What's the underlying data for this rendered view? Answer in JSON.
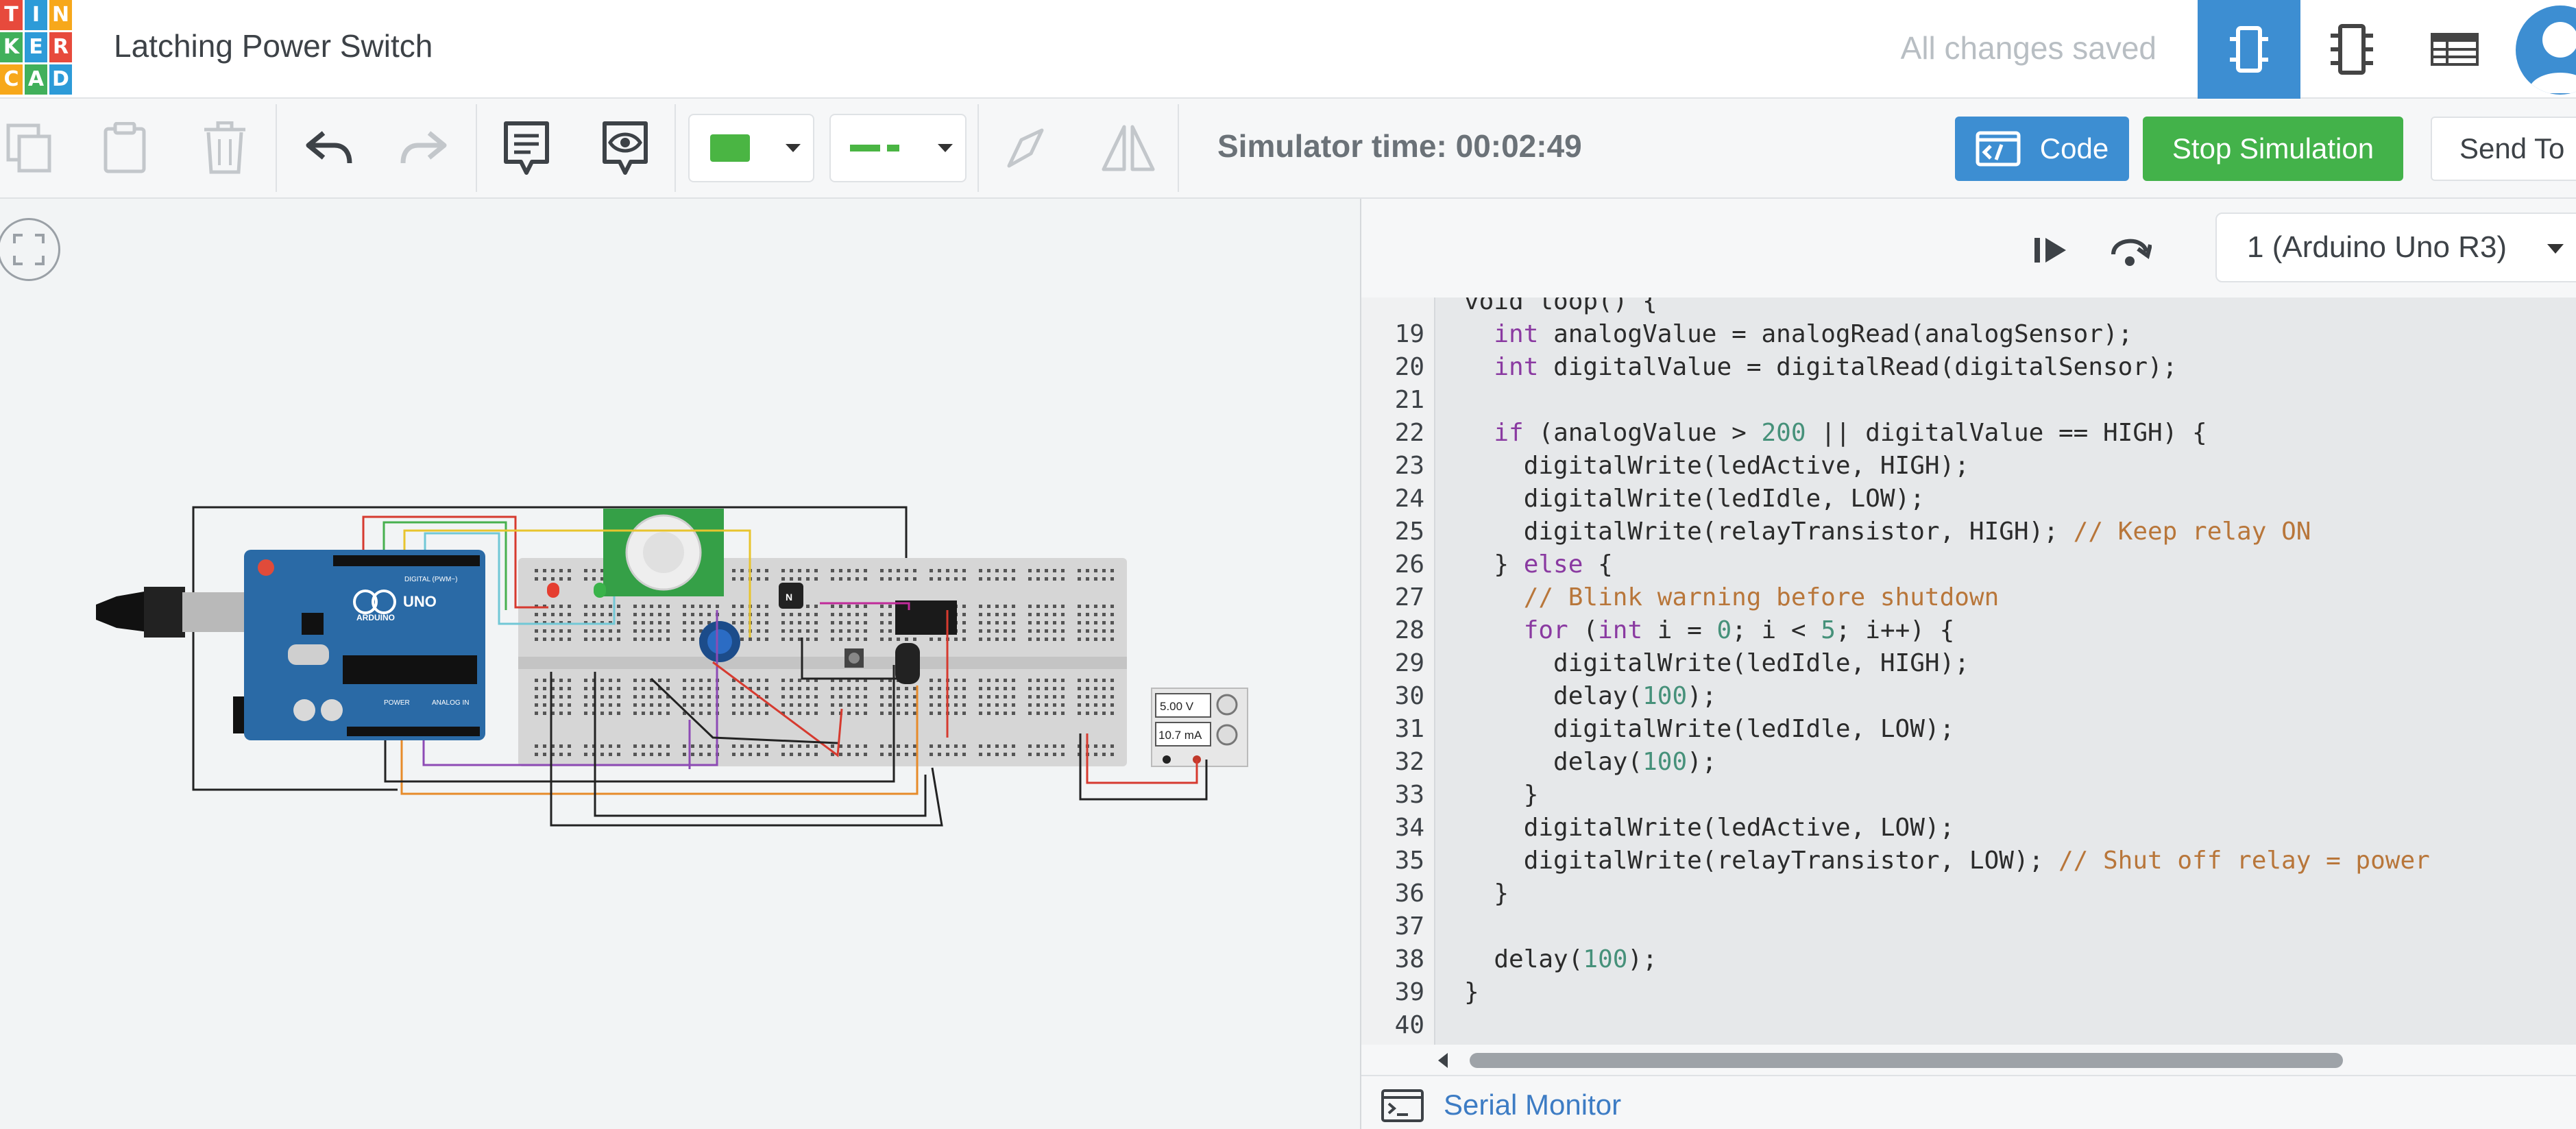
{
  "header": {
    "project_title": "Latching Power Switch",
    "save_status": "All changes saved",
    "logo_letters": [
      "T",
      "I",
      "N",
      "K",
      "E",
      "R",
      "C",
      "A",
      "D"
    ],
    "logo_colors": [
      "#e74a3c",
      "#2d9bd8",
      "#f7a81b",
      "#41b05b",
      "#2d9bd8",
      "#e74a3c",
      "#f7a81b",
      "#41b05b",
      "#2d9bd8"
    ],
    "views": [
      "circuit-view",
      "schematic-view",
      "component-list-view"
    ]
  },
  "toolbar": {
    "sim_time_label": "Simulator time:",
    "sim_time_value": "00:02:49",
    "code_label": "Code",
    "stop_label": "Stop Simulation",
    "send_label": "Send To",
    "color_swatch": "#4ab543"
  },
  "code_panel": {
    "board": "1 (Arduino Uno R3)",
    "serial_monitor": "Serial Monitor",
    "top_fragment": "void loop() {",
    "lines": [
      {
        "n": "19",
        "tokens": [
          [
            "",
            "  "
          ],
          [
            "kw",
            "int"
          ],
          [
            "",
            " analogValue = analogRead(analogSensor);"
          ]
        ]
      },
      {
        "n": "20",
        "tokens": [
          [
            "",
            "  "
          ],
          [
            "kw",
            "int"
          ],
          [
            "",
            " digitalValue = digitalRead(digitalSensor);"
          ]
        ]
      },
      {
        "n": "21",
        "tokens": []
      },
      {
        "n": "22",
        "tokens": [
          [
            "",
            "  "
          ],
          [
            "kw",
            "if"
          ],
          [
            "",
            " (analogValue > "
          ],
          [
            "num",
            "200"
          ],
          [
            "",
            " || digitalValue == HIGH) {"
          ]
        ]
      },
      {
        "n": "23",
        "tokens": [
          [
            "",
            "    digitalWrite(ledActive, HIGH);"
          ]
        ]
      },
      {
        "n": "24",
        "tokens": [
          [
            "",
            "    digitalWrite(ledIdle, LOW);"
          ]
        ]
      },
      {
        "n": "25",
        "tokens": [
          [
            "",
            "    digitalWrite(relayTransistor, HIGH); "
          ],
          [
            "cm",
            "// Keep relay ON"
          ]
        ]
      },
      {
        "n": "26",
        "tokens": [
          [
            "",
            "  } "
          ],
          [
            "kw",
            "else"
          ],
          [
            "",
            " {"
          ]
        ]
      },
      {
        "n": "27",
        "tokens": [
          [
            "",
            "    "
          ],
          [
            "cm",
            "// Blink warning before shutdown"
          ]
        ]
      },
      {
        "n": "28",
        "tokens": [
          [
            "",
            "    "
          ],
          [
            "kw",
            "for"
          ],
          [
            "",
            " ("
          ],
          [
            "kw",
            "int"
          ],
          [
            "",
            " i = "
          ],
          [
            "num",
            "0"
          ],
          [
            "",
            "; i < "
          ],
          [
            "num",
            "5"
          ],
          [
            "",
            "; i++) {"
          ]
        ]
      },
      {
        "n": "29",
        "tokens": [
          [
            "",
            "      digitalWrite(ledIdle, HIGH);"
          ]
        ]
      },
      {
        "n": "30",
        "tokens": [
          [
            "",
            "      delay("
          ],
          [
            "num",
            "100"
          ],
          [
            "",
            ");"
          ]
        ]
      },
      {
        "n": "31",
        "tokens": [
          [
            "",
            "      digitalWrite(ledIdle, LOW);"
          ]
        ]
      },
      {
        "n": "32",
        "tokens": [
          [
            "",
            "      delay("
          ],
          [
            "num",
            "100"
          ],
          [
            "",
            ");"
          ]
        ]
      },
      {
        "n": "33",
        "tokens": [
          [
            "",
            "    }"
          ]
        ]
      },
      {
        "n": "34",
        "tokens": [
          [
            "",
            "    digitalWrite(ledActive, LOW);"
          ]
        ]
      },
      {
        "n": "35",
        "tokens": [
          [
            "",
            "    digitalWrite(relayTransistor, LOW); "
          ],
          [
            "cm",
            "// Shut off relay = power"
          ]
        ]
      },
      {
        "n": "36",
        "tokens": [
          [
            "",
            "  }"
          ]
        ]
      },
      {
        "n": "37",
        "tokens": []
      },
      {
        "n": "38",
        "tokens": [
          [
            "",
            "  delay("
          ],
          [
            "num",
            "100"
          ],
          [
            "",
            ");"
          ]
        ]
      },
      {
        "n": "39",
        "tokens": [
          [
            "",
            "}"
          ]
        ]
      },
      {
        "n": "40",
        "tokens": []
      }
    ]
  },
  "circuit": {
    "arduino_brand": "ARDUINO",
    "arduino_model": "UNO",
    "arduino_digital_label": "DIGITAL (PWM~)",
    "arduino_power_label": "POWER",
    "arduino_analog_label": "ANALOG IN",
    "power_supply_voltage": "5.00 V",
    "power_supply_current": "10.7 mA",
    "transistor_label": "N"
  }
}
